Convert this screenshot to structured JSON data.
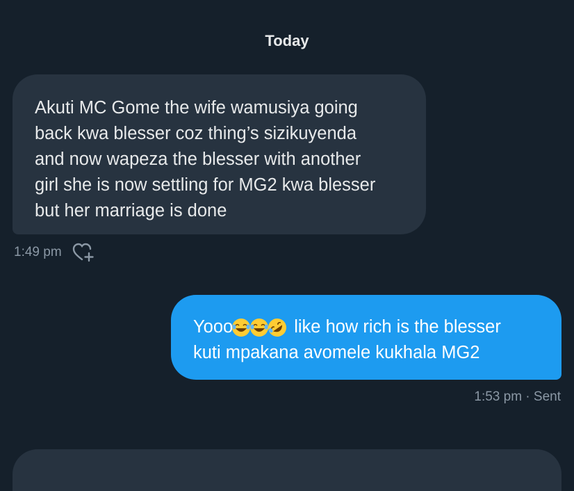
{
  "conversation": {
    "date_header": "Today"
  },
  "messages": [
    {
      "direction": "received",
      "lines": [
        "Akuti MC Gome the wife wamusiya going",
        "back kwa blesser coz thing’s sizikuyenda",
        "and now wapeza the blesser with another",
        "girl she is now settling for MG2 kwa blesser",
        "but her marriage is done"
      ],
      "time": "1:49 pm",
      "react_icon": "add-reaction-heart-icon"
    },
    {
      "direction": "sent",
      "line1_prefix": "Yooo",
      "line1_emojis": [
        "joy-emoji",
        "joy-emoji",
        "rofl-emoji"
      ],
      "line1_suffix": "like how rich is the blesser",
      "line2": "kuti mpakana avomele kukhala MG2",
      "time_status": "1:53 pm · Sent"
    }
  ],
  "colors": {
    "background": "#15202b",
    "received_bubble": "#273340",
    "sent_bubble": "#1d9bf0",
    "meta_text": "#8b98a5",
    "text": "#e7e9ea"
  }
}
